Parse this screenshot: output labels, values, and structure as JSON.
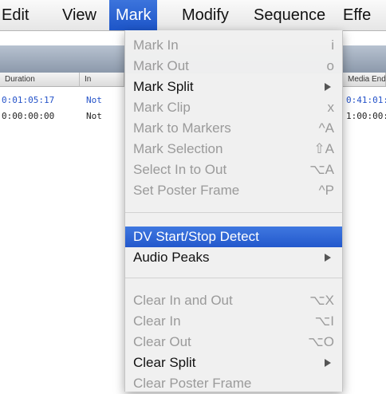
{
  "menubar": {
    "items": [
      {
        "label": "Edit"
      },
      {
        "label": "View"
      },
      {
        "label": "Mark"
      },
      {
        "label": "Modify"
      },
      {
        "label": "Sequence"
      },
      {
        "label": "Effe"
      }
    ]
  },
  "browser": {
    "columns": [
      "Duration",
      "In",
      "Media End"
    ],
    "rows": [
      {
        "duration": "0:01:05:17",
        "in": "Not",
        "media_end": "0:41:01:"
      },
      {
        "duration": "0:00:00:00",
        "in": "Not",
        "media_end": "1:00:00:"
      }
    ]
  },
  "mark_menu": {
    "items": [
      {
        "label": "Mark In",
        "shortcut": "i",
        "state": "disabled"
      },
      {
        "label": "Mark Out",
        "shortcut": "o",
        "state": "disabled"
      },
      {
        "label": "Mark Split",
        "shortcut": "",
        "state": "enabled",
        "submenu": true
      },
      {
        "label": "Mark Clip",
        "shortcut": "x",
        "state": "disabled"
      },
      {
        "label": "Mark to Markers",
        "shortcut": "^A",
        "state": "disabled"
      },
      {
        "label": "Mark Selection",
        "shortcut": "⇧A",
        "state": "disabled"
      },
      {
        "label": "Select In to Out",
        "shortcut": "⌥A",
        "state": "disabled"
      },
      {
        "label": "Set Poster Frame",
        "shortcut": "^P",
        "state": "disabled"
      },
      {
        "label": "DV Start/Stop Detect",
        "shortcut": "",
        "state": "highlighted"
      },
      {
        "label": "Audio Peaks",
        "shortcut": "",
        "state": "enabled",
        "submenu": true
      },
      {
        "label": "Clear In and Out",
        "shortcut": "⌥X",
        "state": "disabled"
      },
      {
        "label": "Clear In",
        "shortcut": "⌥I",
        "state": "disabled"
      },
      {
        "label": "Clear Out",
        "shortcut": "⌥O",
        "state": "disabled"
      },
      {
        "label": "Clear Split",
        "shortcut": "",
        "state": "enabled",
        "submenu": true
      },
      {
        "label": "Clear Poster Frame",
        "shortcut": "",
        "state": "disabled"
      }
    ]
  },
  "colors": {
    "highlight": "#2358cc",
    "disabled_text": "#9a9a9a",
    "timecode_blue": "#2553c9"
  }
}
